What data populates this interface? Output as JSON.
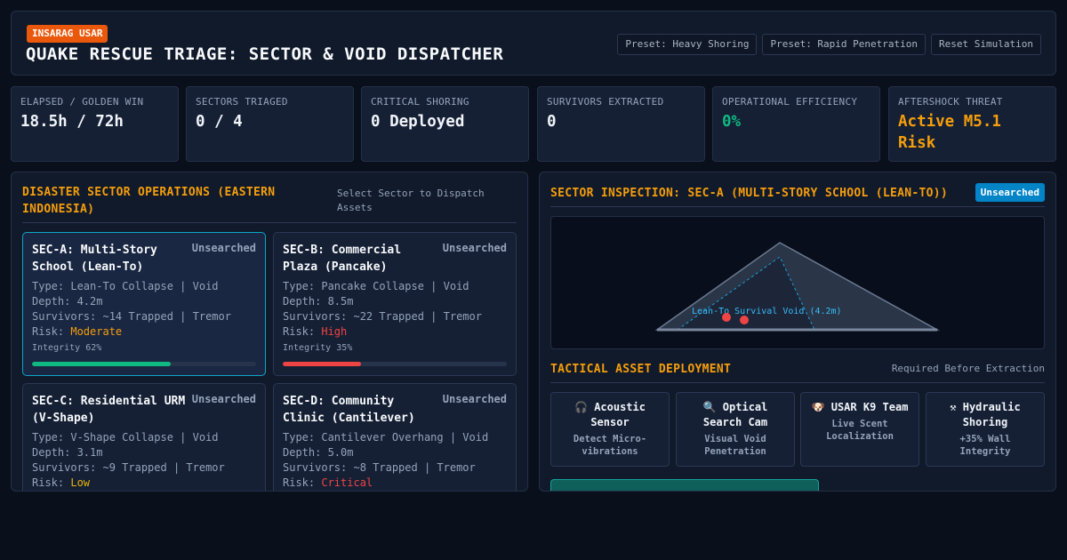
{
  "header": {
    "org_badge": "INSARAG USAR",
    "title": "QUAKE RESCUE TRIAGE: SECTOR & VOID DISPATCHER",
    "buttons": [
      "Preset: Heavy Shoring",
      "Preset: Rapid Penetration",
      "Reset Simulation"
    ]
  },
  "stats": [
    {
      "label": "ELAPSED / GOLDEN WIN",
      "value": "18.5h / 72h",
      "tone": "default"
    },
    {
      "label": "SECTORS TRIAGED",
      "value": "0 / 4",
      "tone": "default"
    },
    {
      "label": "CRITICAL SHORING",
      "value": "0 Deployed",
      "tone": "default"
    },
    {
      "label": "SURVIVORS EXTRACTED",
      "value": "0",
      "tone": "default"
    },
    {
      "label": "OPERATIONAL EFFICIENCY",
      "value": "0%",
      "tone": "green"
    },
    {
      "label": "AFTERSHOCK THREAT",
      "value": "Active M5.1 Risk",
      "tone": "orange"
    }
  ],
  "sector_panel": {
    "title": "DISASTER SECTOR OPERATIONS (EASTERN INDONESIA)",
    "hint": "Select Sector to Dispatch Assets",
    "sectors": [
      {
        "name": "SEC-A: Multi-Story School (Lean-To)",
        "status": "Unsearched",
        "type_line": "Type: Lean-To Collapse | Void Depth: 4.2m",
        "survivors_line": "Survivors: ~14 Trapped | Tremor",
        "risk_label": "Risk: ",
        "risk": "Moderate",
        "integrity_label": "Integrity 62%",
        "integrity": 62,
        "bar_color": "#10b981",
        "selected": true
      },
      {
        "name": "SEC-B: Commercial Plaza (Pancake)",
        "status": "Unsearched",
        "type_line": "Type: Pancake Collapse | Void Depth: 8.5m",
        "survivors_line": "Survivors: ~22 Trapped | Tremor",
        "risk_label": "Risk: ",
        "risk": "High",
        "integrity_label": "Integrity 35%",
        "integrity": 35,
        "bar_color": "#ef4444",
        "selected": false
      },
      {
        "name": "SEC-C: Residential URM (V-Shape)",
        "status": "Unsearched",
        "type_line": "Type: V-Shape Collapse | Void Depth: 3.1m",
        "survivors_line": "Survivors: ~9 Trapped | Tremor",
        "risk_label": "Risk: ",
        "risk": "Low",
        "selected": false
      },
      {
        "name": "SEC-D: Community Clinic (Cantilever)",
        "status": "Unsearched",
        "type_line": "Type: Cantilever Overhang | Void Depth: 5.0m",
        "survivors_line": "Survivors: ~8 Trapped | Tremor",
        "risk_label": "Risk: ",
        "risk": "Critical",
        "selected": false
      }
    ]
  },
  "inspection_panel": {
    "title": "SECTOR INSPECTION: SEC-A (MULTI-STORY SCHOOL (LEAN-TO))",
    "status": "Unsearched",
    "void_label": "Lean-To Survival Void (4.2m)",
    "assets_title": "TACTICAL ASSET DEPLOYMENT",
    "assets_hint": "Required Before Extraction",
    "assets": [
      {
        "icon": "🎧",
        "icon_name": "headphones-icon",
        "name": "Acoustic Sensor",
        "desc": "Detect Micro-vibrations"
      },
      {
        "icon": "🔍",
        "icon_name": "magnifier-icon",
        "name": "Optical Search Cam",
        "desc": "Visual Void Penetration"
      },
      {
        "icon": "🐶",
        "icon_name": "dog-icon",
        "name": "USAR K9 Team",
        "desc": "Live Scent Localization"
      },
      {
        "icon": "⚒",
        "icon_name": "hammer-pick-icon",
        "name": "Hydraulic Shoring",
        "desc": "+35% Wall Integrity"
      }
    ]
  },
  "colors": {
    "accent": "#f59e0b",
    "selected_border": "#0ea5c6",
    "badge_blue": "#0284c7",
    "org_orange": "#ea580c",
    "efficiency_green": "#10b981"
  }
}
